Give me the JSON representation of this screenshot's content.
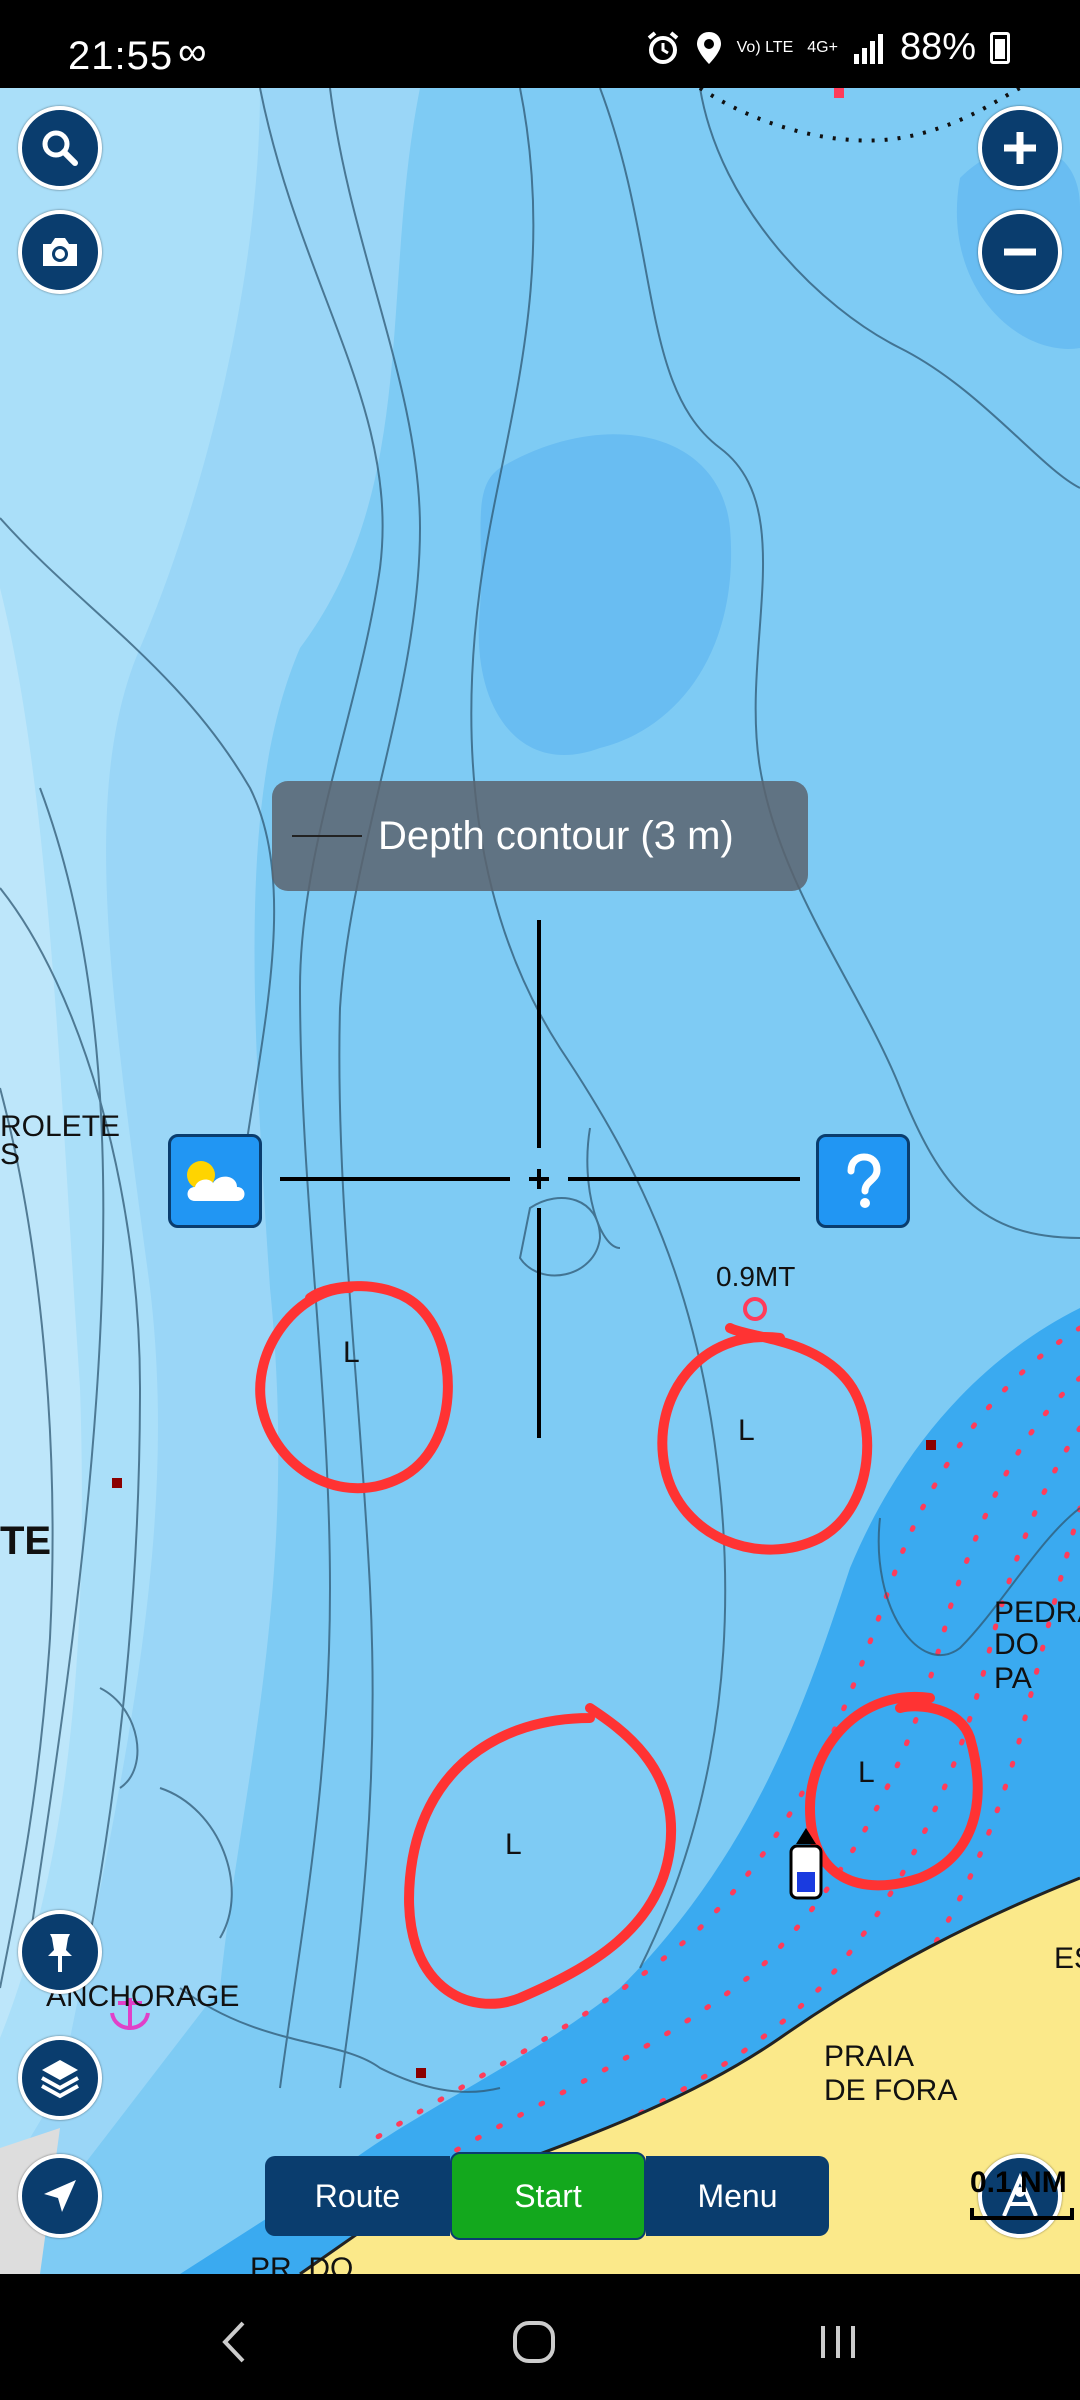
{
  "status_bar": {
    "time": "21:55",
    "link_glyph": "∞",
    "volte": "Vo) LTE",
    "network": "4G+",
    "battery": "88%"
  },
  "tooltip": {
    "text": "Depth contour  (3 m)"
  },
  "map_labels": {
    "rolete": "ROLETE",
    "rolete_sub": "S",
    "te": "TE",
    "buoy": "0.9MT",
    "l1": "L",
    "l2": "L",
    "l3": "L",
    "l4": "L",
    "pedra": "PEDRA",
    "do_pa": "DO PA",
    "es": "ES",
    "anchorage": "ANCHORAGE",
    "praia_1": "PRAIA",
    "praia_2": "DE FORA",
    "pr_do": "PR. DO"
  },
  "scale": {
    "label": "0.1 NM"
  },
  "bottom_bar": {
    "route": "Route",
    "start": "Start",
    "menu": "Menu"
  },
  "colors": {
    "map_water": "#7ecbf4",
    "shallow": "#3aaaf0",
    "land": "#fbe98a",
    "button_navy": "#0a3d6e",
    "start_green": "#13a81d",
    "annotation_red": "#ff3333"
  }
}
